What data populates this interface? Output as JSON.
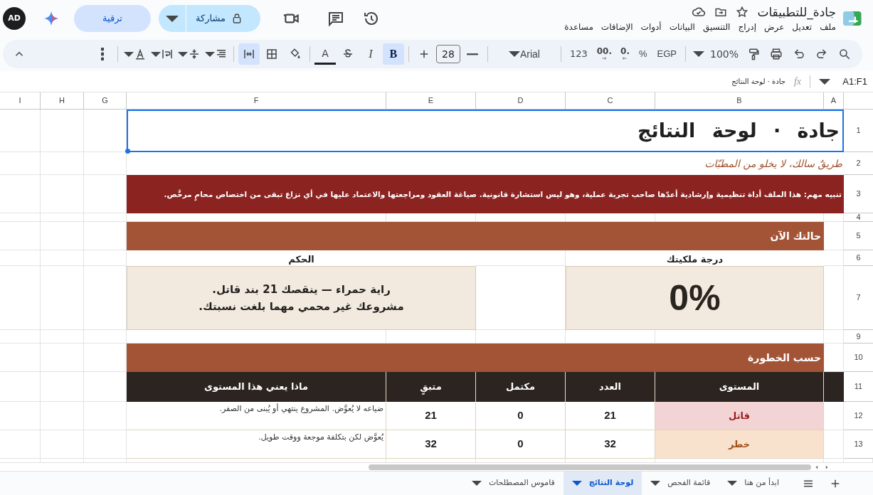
{
  "app": {
    "title": "جادة_للتطبيقات",
    "avatar_text": "AD",
    "upgrade_label": "ترقية",
    "share_label": "مشاركة",
    "menu": [
      "ملف",
      "تعديل",
      "عرض",
      "إدراج",
      "التنسيق",
      "البيانات",
      "أدوات",
      "الإضافات",
      "مساعدة"
    ]
  },
  "toolbar": {
    "zoom": "100%",
    "currency": "EGP",
    "percent": "%",
    "decimals_decrease": ".0",
    "decimals_increase": ".00",
    "number_format": "123",
    "font": "Arial",
    "font_size": "28",
    "format_buttons": [
      {
        "kind": "bold",
        "label": "B",
        "selected": true
      },
      {
        "kind": "italic",
        "label": "I",
        "selected": false
      }
    ],
    "text_color_label": "A",
    "merge_selected": true
  },
  "formula_bar": {
    "cell_ref": "A1:F1",
    "fx": "fx",
    "content": "جادة · لوحة النتائج"
  },
  "sheet": {
    "columns": [
      "A",
      "B",
      "C",
      "D",
      "E",
      "F",
      "G",
      "H",
      "I"
    ],
    "row_numbers": [
      "1",
      "2",
      "3",
      "4",
      "5",
      "6",
      "7",
      "9",
      "10",
      "11",
      "12",
      "13"
    ],
    "title": "جادة · لوحة النتائج",
    "subtitle": "طريقٌ سالك، لا يخلو من المطبّات",
    "notice": "تنبيه مهم:  هذا الملف أداة تنظيمية وإرشادية أعدّها صاحب تجربة عملية،  وهو ليس استشارة قانونية. صياغة العقود ومراجعتها والاعتماد عليها في أي نزاع تبقى من اختصاص محامٍ مرخَّص.",
    "status_section": {
      "heading": "حالتك الآن",
      "score_label": "درجة ملكيتك",
      "score": "0%",
      "verdict_label": "الحكم",
      "verdict_lines": [
        "راية حمراء — ينقصك 21 بند قاتل.",
        "مشروعك غير محمي مهما بلغت نسبتك."
      ]
    },
    "severity_section": {
      "heading": "حسب الخطورة",
      "columns": [
        "المستوى",
        "العدد",
        "مكتمل",
        "متبقٍ",
        "ماذا يعني هذا المستوى"
      ],
      "rows": [
        {
          "kind": "fatal",
          "color": "#f3d4d5",
          "level": "قاتل",
          "count": "21",
          "done": "0",
          "remaining": "21",
          "meaning": "ضياعه لا يُعوَّض. المشروع ينتهي أو يُبنى من الصفر."
        },
        {
          "kind": "danger",
          "color": "#f8e2cd",
          "level": "خطر",
          "count": "32",
          "done": "0",
          "remaining": "32",
          "meaning": "يُعوَّض لكن بتكلفة موجعة ووقت طويل."
        }
      ]
    }
  },
  "sheet_tabs": [
    {
      "label": "ابدأ من هنا",
      "selected": false
    },
    {
      "label": "قائمة الفحص",
      "selected": false
    },
    {
      "label": "لوحة النتائج",
      "selected": true
    },
    {
      "label": "قاموس المصطلحات",
      "selected": false
    }
  ]
}
